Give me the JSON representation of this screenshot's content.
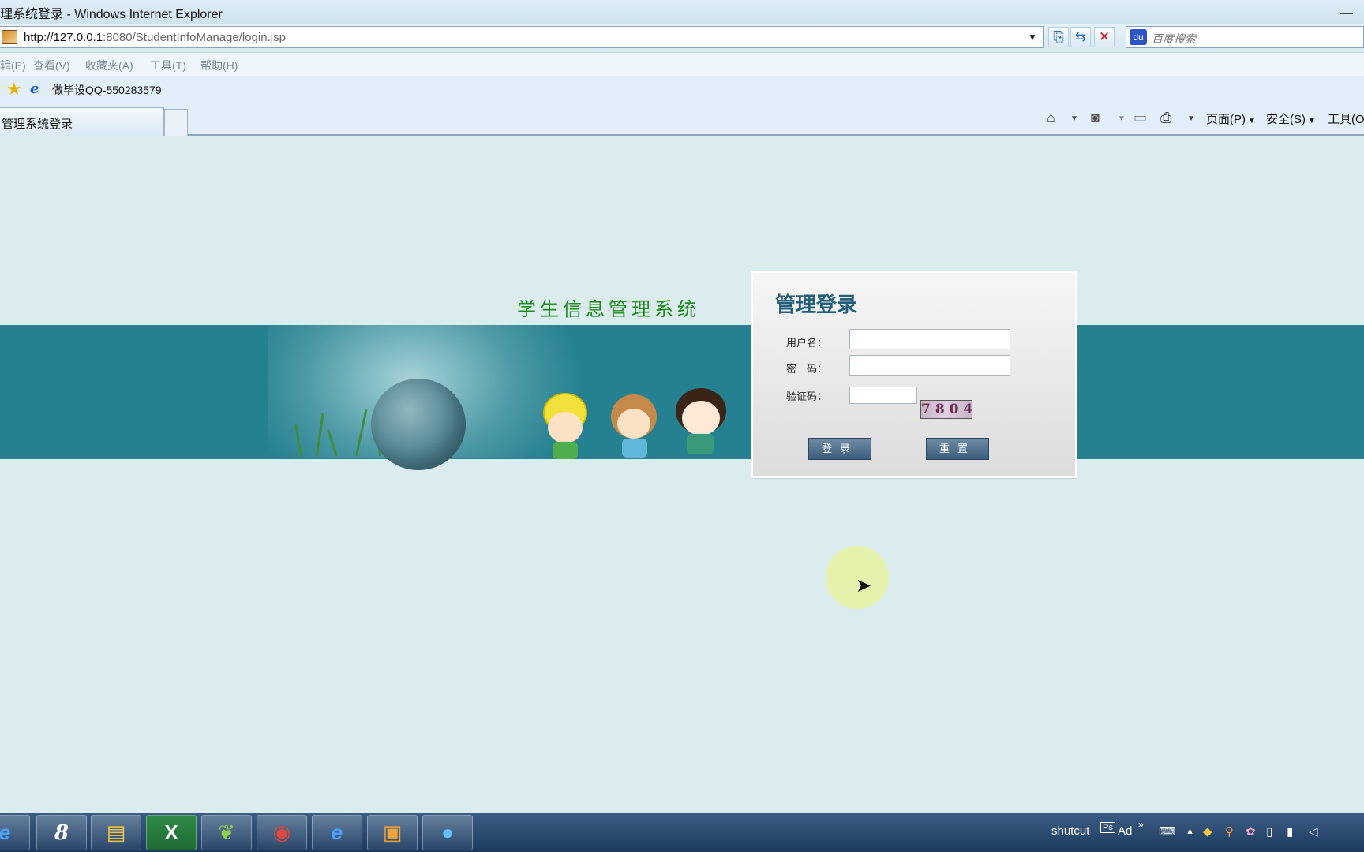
{
  "window": {
    "title": "理系统登录 - Windows Internet Explorer"
  },
  "address": {
    "url_host": "http://127.0.0.1",
    "url_rest": ":8080/StudentInfoManage/login.jsp",
    "search_placeholder": "百度搜索"
  },
  "menu": {
    "items": [
      "辑(E)",
      "查看(V)",
      "收藏夹(A)",
      "工具(T)",
      "帮助(H)"
    ]
  },
  "favorites": {
    "item": "做毕设QQ-550283579"
  },
  "tabs": {
    "active": "管理系统登录"
  },
  "commandbar": {
    "page": "页面(P)",
    "safety": "安全(S)",
    "tools": "工具(O"
  },
  "page": {
    "system_title": "学生信息管理系统",
    "login": {
      "heading": "管理登录",
      "username_label": "用户名：",
      "password_label": "密　码：",
      "captcha_label": "验证码：",
      "captcha_value": "7804",
      "login_button": "登录",
      "reset_button": "重置"
    }
  },
  "taskbar": {
    "apps": [
      "internet-explorer",
      "pinyin-input",
      "file-explorer",
      "excel",
      "browser-leaf",
      "chrome",
      "internet-explorer",
      "app-box",
      "qq-bird"
    ],
    "tray_text": "shutcut",
    "tray_ad": "Ad"
  },
  "colors": {
    "band": "#25808f",
    "page_bg": "#daeced",
    "title_green": "#1b8b1b",
    "button": "#4a6a88"
  }
}
